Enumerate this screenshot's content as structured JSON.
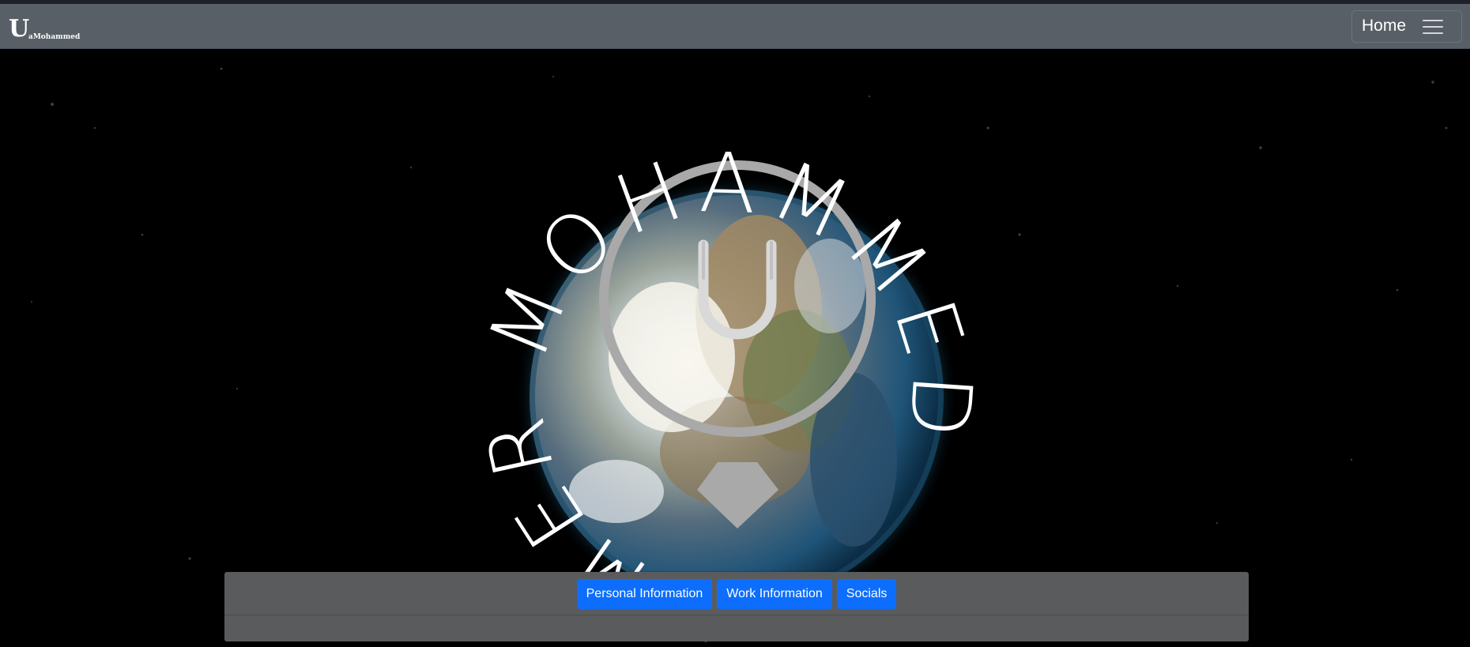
{
  "navbar": {
    "brand_letter": "U",
    "brand_name": "aMohammed",
    "home_label": "Home",
    "menu_icon": "hamburger-menu-icon"
  },
  "hero": {
    "ring_text": "UMER MOHAMMED",
    "emblem_letter": "U",
    "background": "earth-in-space",
    "emblem_color": "#a9a9a9"
  },
  "tabs": {
    "personal_label": "Personal Information",
    "work_label": "Work Information",
    "socials_label": "Socials"
  },
  "colors": {
    "accent": "#0d6efd",
    "navbar": "#585f67",
    "panel": "#5a5b5d"
  }
}
